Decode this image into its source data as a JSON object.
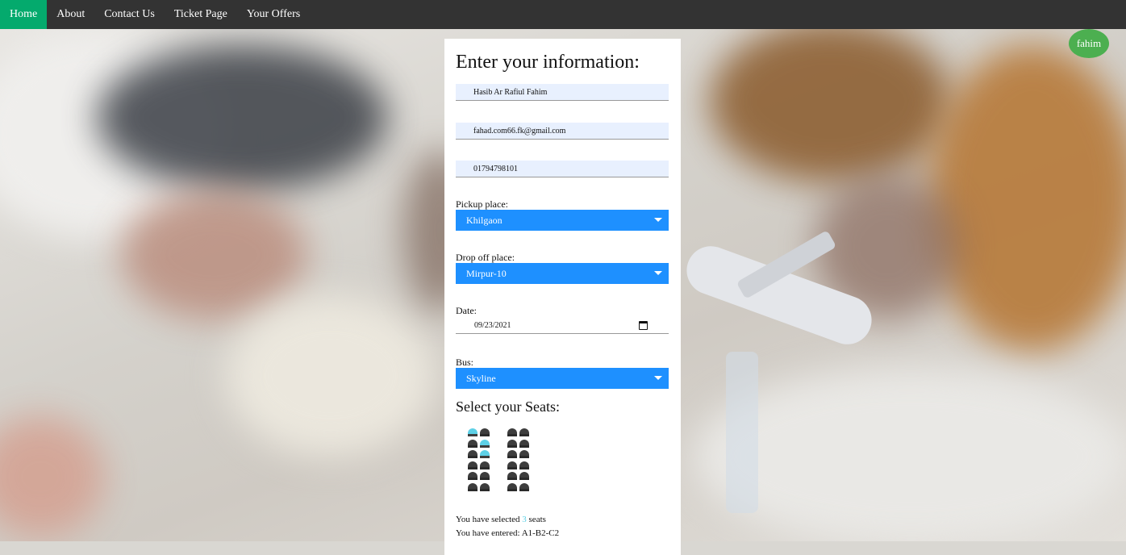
{
  "nav": {
    "items": [
      {
        "label": "Home",
        "active": true
      },
      {
        "label": "About",
        "active": false
      },
      {
        "label": "Contact Us",
        "active": false
      },
      {
        "label": "Ticket Page",
        "active": false
      },
      {
        "label": "Your Offers",
        "active": false
      }
    ],
    "active_color": "#04aa6d",
    "bar_color": "#333333"
  },
  "profile": {
    "name": "fahim",
    "color": "#4caf50"
  },
  "form": {
    "title": "Enter your information:",
    "name_value": "Hasib Ar Rafiul Fahim",
    "email_value": "fahad.com66.fk@gmail.com",
    "phone_value": "01794798101",
    "pickup": {
      "label": "Pickup place:",
      "value": "Khilgaon"
    },
    "dropoff": {
      "label": "Drop off place:",
      "value": "Mirpur-10"
    },
    "date": {
      "label": "Date:",
      "value": "09/23/2021"
    },
    "bus": {
      "label": "Bus:",
      "value": "Skyline"
    },
    "select_color": "#1e90ff"
  },
  "seats": {
    "title": "Select your Seats:",
    "rows": [
      "A",
      "B",
      "C",
      "D",
      "E",
      "F"
    ],
    "selected": [
      "A1",
      "B2",
      "C2"
    ],
    "selected_color": "#5dd0e6"
  },
  "summary": {
    "selected_prefix": "You have selected",
    "selected_count": "3",
    "selected_suffix": "seats",
    "entered_prefix": "You have entered:",
    "entered_value": "A1-B2-C2"
  }
}
